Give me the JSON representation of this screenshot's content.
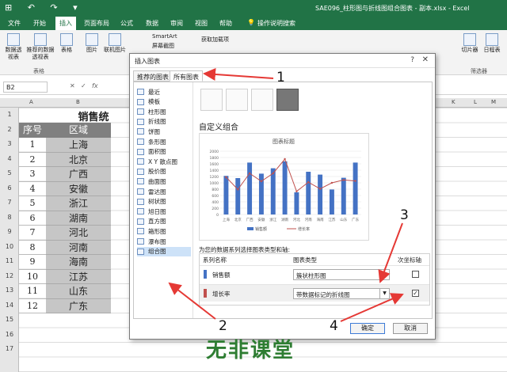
{
  "app": {
    "title": "SAE096_柱形图与折线图组合图表 - 副本.xlsx  -  Excel",
    "quick_access": "⊞ ↶ ↷ ▾"
  },
  "menu_tabs": [
    "文件",
    "开始",
    "插入",
    "页面布局",
    "公式",
    "数据",
    "审阅",
    "视图",
    "帮助",
    "操作说明搜索"
  ],
  "ribbon": {
    "buttons": [
      "数据透视表",
      "推荐的数据透视表",
      "表格",
      "图片",
      "联机图片",
      "获取加载项",
      "切片器",
      "日程表"
    ],
    "smartart": "SmartArt",
    "screenshot": "屏幕截图",
    "groups": [
      "表格",
      "筛选器"
    ]
  },
  "formula_bar": {
    "name_box": "B2",
    "fx": "fx"
  },
  "sheet": {
    "col_labels": [
      "A",
      "B",
      "K",
      "L",
      "M",
      "N"
    ],
    "row_numbers": [
      "1",
      "2",
      "3",
      "4",
      "5",
      "6",
      "7",
      "8",
      "9",
      "10",
      "11",
      "12",
      "13",
      "14",
      "15",
      "16",
      "17"
    ],
    "title": "销售统",
    "header_seq": "序号",
    "header_region": "区域",
    "rows": [
      [
        "1",
        "上海"
      ],
      [
        "2",
        "北京"
      ],
      [
        "3",
        "广西"
      ],
      [
        "4",
        "安徽"
      ],
      [
        "5",
        "浙江"
      ],
      [
        "6",
        "湖南"
      ],
      [
        "7",
        "河北"
      ],
      [
        "8",
        "河南"
      ],
      [
        "9",
        "海南"
      ],
      [
        "10",
        "江苏"
      ],
      [
        "11",
        "山东"
      ],
      [
        "12",
        "广东"
      ]
    ]
  },
  "dialog": {
    "title": "插入图表",
    "help": "?",
    "close": "✕",
    "tab_recommended": "推荐的图表",
    "tab_all": "所有图表",
    "chart_types": [
      "最近",
      "模板",
      "柱形图",
      "折线图",
      "饼图",
      "条形图",
      "面积图",
      "X Y 散点图",
      "股价图",
      "曲面图",
      "雷达图",
      "树状图",
      "旭日图",
      "直方图",
      "箱形图",
      "瀑布图",
      "组合图"
    ],
    "selected_type": "组合图",
    "subtitle": "自定义组合",
    "series_prompt": "为您的数据系列选择图表类型和轴:",
    "col_series": "系列名称",
    "col_type": "图表类型",
    "col_axis": "次坐标轴",
    "series": [
      {
        "name": "销售额",
        "type": "簇状柱形图",
        "secondary": "",
        "color": "#4472c4"
      },
      {
        "name": "增长率",
        "type": "带数据标记的折线图",
        "secondary": "✓",
        "color": "#c0504d"
      }
    ],
    "ok": "确定",
    "cancel": "取消"
  },
  "chart_data": {
    "type": "bar",
    "title": "图表标题",
    "categories": [
      "上海",
      "北京",
      "广西",
      "安徽",
      "浙江",
      "湖南",
      "河北",
      "河南",
      "海南",
      "江苏",
      "山东",
      "广东"
    ],
    "series": [
      {
        "name": "销售额",
        "kind": "bar",
        "color": "#4472c4",
        "values": [
          1220,
          1150,
          1640,
          1290,
          1460,
          1680,
          700,
          1350,
          1260,
          790,
          1160,
          1640
        ]
      },
      {
        "name": "增长率",
        "kind": "line",
        "color": "#c0504d",
        "axis": "secondary",
        "values": [
          1180,
          790,
          1300,
          1050,
          1300,
          1750,
          730,
          1020,
          810,
          1000,
          1090,
          1060
        ]
      }
    ],
    "yticks": [
      "2000",
      "1800",
      "1600",
      "1400",
      "1200",
      "1000",
      "800",
      "600",
      "400",
      "200",
      "0"
    ],
    "ylim": [
      0,
      2000
    ],
    "legend": "bottom"
  },
  "annotations": [
    "1",
    "2",
    "3",
    "4"
  ],
  "watermark": "无非课堂"
}
